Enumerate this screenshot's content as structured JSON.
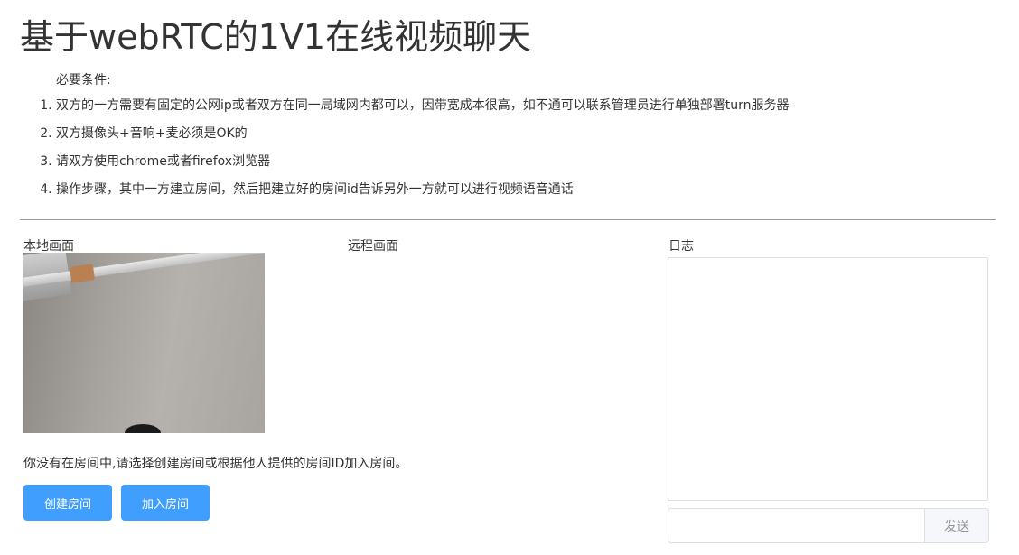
{
  "page": {
    "title": "基于webRTC的1V1在线视频聊天"
  },
  "requirements": {
    "heading": "必要条件:",
    "items": [
      "双方的一方需要有固定的公网ip或者双方在同一局域网内都可以，因带宽成本很高，如不通可以联系管理员进行单独部署turn服务器",
      "双方摄像头+音响+麦必须是OK的",
      "请双方使用chrome或者firefox浏览器",
      "操作步骤，其中一方建立房间，然后把建立好的房间id告诉另外一方就可以进行视频语音通话"
    ]
  },
  "local": {
    "label": "本地画面"
  },
  "remote": {
    "label": "远程画面"
  },
  "room": {
    "status": "你没有在房间中,请选择创建房间或根据他人提供的房间ID加入房间。",
    "create_label": "创建房间",
    "join_label": "加入房间"
  },
  "log": {
    "label": "日志",
    "input_value": "",
    "send_label": "发送"
  },
  "colors": {
    "primary": "#409eff",
    "border": "#dcdfe6",
    "text": "#333333"
  }
}
